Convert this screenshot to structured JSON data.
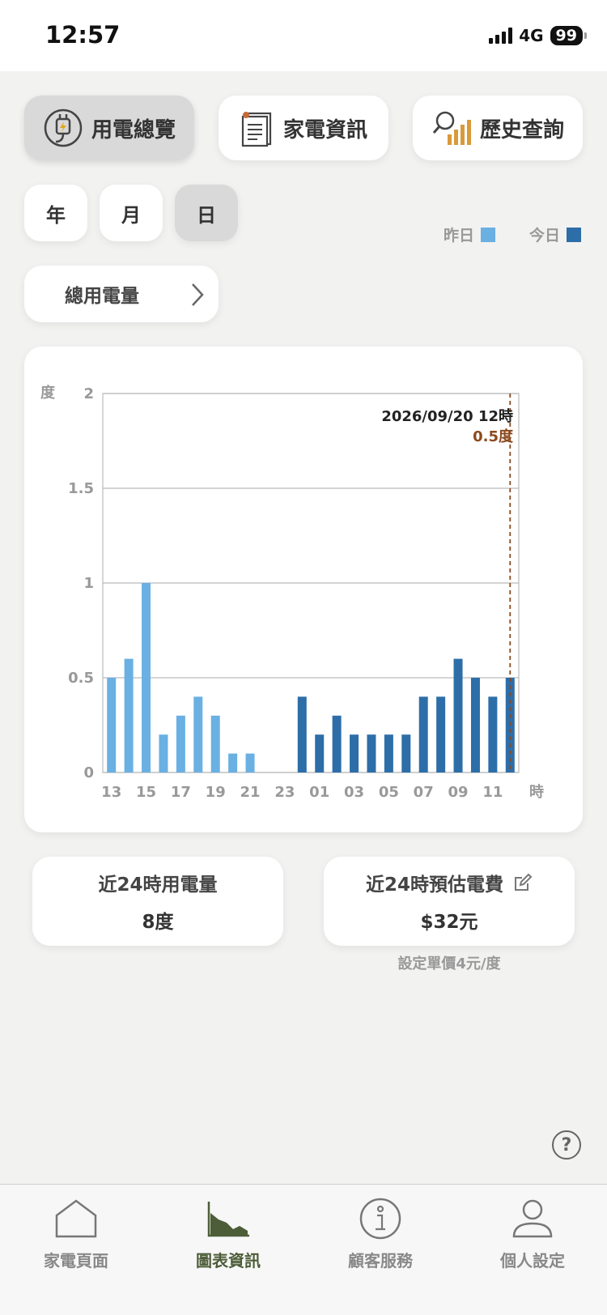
{
  "status_bar": {
    "time": "12:57",
    "network": "4G",
    "battery": "99"
  },
  "tabs": [
    {
      "label": "用電總覽",
      "icon": "plug-icon",
      "active": true
    },
    {
      "label": "家電資訊",
      "icon": "document-icon",
      "active": false
    },
    {
      "label": "歷史查詢",
      "icon": "magnifier-chart-icon",
      "active": false
    }
  ],
  "period": {
    "options": [
      "年",
      "月",
      "日"
    ],
    "selected": "日"
  },
  "legend": {
    "yesterday": {
      "label": "昨日",
      "color": "#6ab0e2"
    },
    "today": {
      "label": "今日",
      "color": "#2d6ea8"
    }
  },
  "selector": {
    "label": "總用電量"
  },
  "chart_data": {
    "type": "bar",
    "ylabel": "度",
    "xlabel": "時",
    "ylim": [
      0,
      2
    ],
    "yticks": [
      "0",
      "0.5",
      "1",
      "1.5",
      "2"
    ],
    "grid": true,
    "categories": [
      "13",
      "14",
      "15",
      "16",
      "17",
      "18",
      "19",
      "20",
      "21",
      "22",
      "23",
      "00",
      "01",
      "02",
      "03",
      "04",
      "05",
      "06",
      "07",
      "08",
      "09",
      "10",
      "11",
      "12"
    ],
    "x_tick_labels": [
      "13",
      "15",
      "17",
      "19",
      "21",
      "23",
      "01",
      "03",
      "05",
      "07",
      "09",
      "11"
    ],
    "series": [
      {
        "name": "昨日",
        "color": "#6ab0e2",
        "values": [
          0.5,
          0.6,
          1.0,
          0.2,
          0.3,
          0.4,
          0.3,
          0.1,
          0.1,
          0,
          0,
          null,
          null,
          null,
          null,
          null,
          null,
          null,
          null,
          null,
          null,
          null,
          null,
          null
        ]
      },
      {
        "name": "今日",
        "color": "#2d6ea8",
        "values": [
          null,
          null,
          null,
          null,
          null,
          null,
          null,
          null,
          null,
          null,
          null,
          0.4,
          0.2,
          0.3,
          0.2,
          0.2,
          0.2,
          0.2,
          0.4,
          0.4,
          0.6,
          0.5,
          0.4,
          0.5
        ]
      }
    ],
    "tooltip": {
      "date": "2026/09/20 12時",
      "value": "0.5度",
      "color": "#8b4a1e"
    }
  },
  "stats": {
    "usage": {
      "title": "近24時用電量",
      "value": "8度"
    },
    "cost": {
      "title": "近24時預估電費",
      "value": "$32元",
      "icon": "edit-icon"
    },
    "price_note": "設定單價4元/度"
  },
  "help": {
    "symbol": "?"
  },
  "nav": [
    {
      "label": "家電頁面",
      "icon": "home-icon",
      "active": false
    },
    {
      "label": "圖表資訊",
      "icon": "chart-icon",
      "active": true
    },
    {
      "label": "顧客服務",
      "icon": "info-icon",
      "active": false
    },
    {
      "label": "個人設定",
      "icon": "person-icon",
      "active": false
    }
  ]
}
